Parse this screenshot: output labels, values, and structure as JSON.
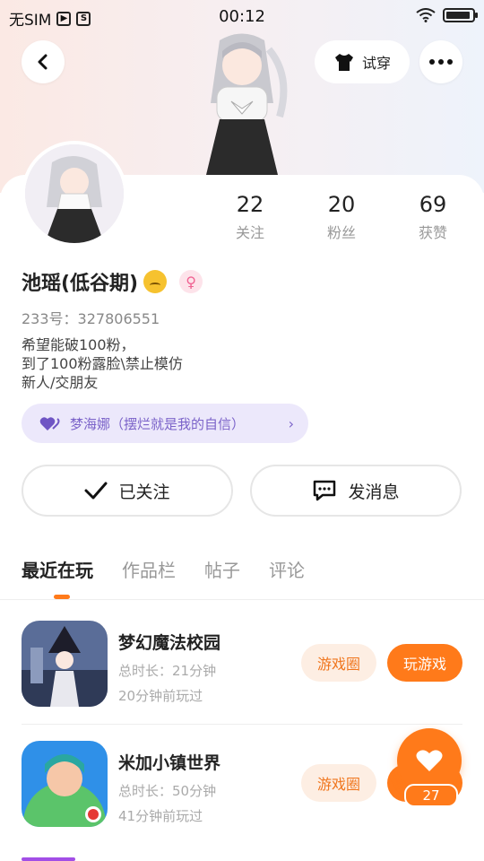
{
  "status_bar": {
    "carrier": "无SIM",
    "time": "00:12"
  },
  "header": {
    "try_on_label": "试穿"
  },
  "stats": [
    {
      "value": "22",
      "label": "关注"
    },
    {
      "value": "20",
      "label": "粉丝"
    },
    {
      "value": "69",
      "label": "获赞"
    }
  ],
  "profile": {
    "name": "池瑶(低谷期)",
    "gender_symbol": "♀",
    "uid": "233号：327806551",
    "bio": [
      "希望能破100粉，",
      "到了100粉露脸\\禁止模仿",
      "新人/交朋友"
    ],
    "group": "梦海娜（摆烂就是我的自信）"
  },
  "actions": {
    "follow_label": "已关注",
    "message_label": "发消息"
  },
  "tabs": [
    "最近在玩",
    "作品栏",
    "帖子",
    "评论"
  ],
  "games": [
    {
      "title": "梦幻魔法校园",
      "duration": "总时长：21分钟",
      "last_played": "20分钟前玩过",
      "circle_label": "游戏圈",
      "play_label": "玩游戏"
    },
    {
      "title": "米加小镇世界",
      "duration": "总时长：50分钟",
      "last_played": "41分钟前玩过",
      "circle_label": "游戏圈"
    }
  ],
  "floating_like": {
    "count": "27"
  },
  "colors": {
    "accent": "#ff7a1a",
    "pill_bg": "#ece8fb",
    "pill_text": "#7b63c9"
  }
}
